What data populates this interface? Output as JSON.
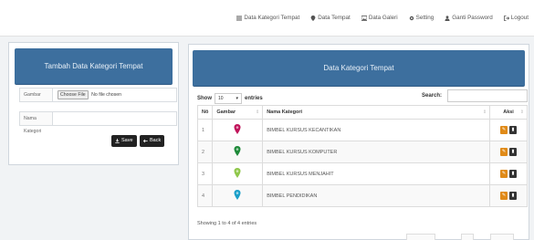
{
  "nav": {
    "items": [
      {
        "label": "Data Kategori Tempat",
        "icon": "list-icon"
      },
      {
        "label": "Data Tempat",
        "icon": "map-marker-icon"
      },
      {
        "label": "Data Galeri",
        "icon": "image-icon"
      },
      {
        "label": "Setting",
        "icon": "gear-icon"
      },
      {
        "label": "Ganti Password",
        "icon": "user-icon"
      },
      {
        "label": "Logout",
        "icon": "logout-icon"
      }
    ]
  },
  "form": {
    "title": "Tambah Data Kategori Tempat",
    "gambar_label": "Gambar",
    "choose_file": "Choose File",
    "no_file": "No file chosen",
    "nama_label": "Nama Kategori",
    "nama_value": "",
    "save_label": "Save",
    "back_label": "Back"
  },
  "table": {
    "title": "Data Kategori Tempat",
    "show_label": "Show",
    "entries_value": "10",
    "entries_label": "entries",
    "search_label": "Search:",
    "search_value": "",
    "headers": [
      "Nō",
      "Gambar",
      "Nama Kategori",
      "Aksi"
    ],
    "rows": [
      {
        "no": "1",
        "pin_color": "#c0135a",
        "nama": "BIMBEL KURSUS KECANTIKAN"
      },
      {
        "no": "2",
        "pin_color": "#1f8a3a",
        "nama": "BIMBEL KURSUS KOMPUTER"
      },
      {
        "no": "3",
        "pin_color": "#8fc74a",
        "nama": "BIMBEL KURSUS MENJAHIT"
      },
      {
        "no": "4",
        "pin_color": "#1a9fc9",
        "nama": "BIMBEL PENDIDIKAN"
      }
    ],
    "info": "Showing 1 to 4 of 4 entries"
  },
  "colors": {
    "panel_header": "#3d6f9e",
    "edit_button": "#e08a18",
    "delete_button": "#333333"
  }
}
